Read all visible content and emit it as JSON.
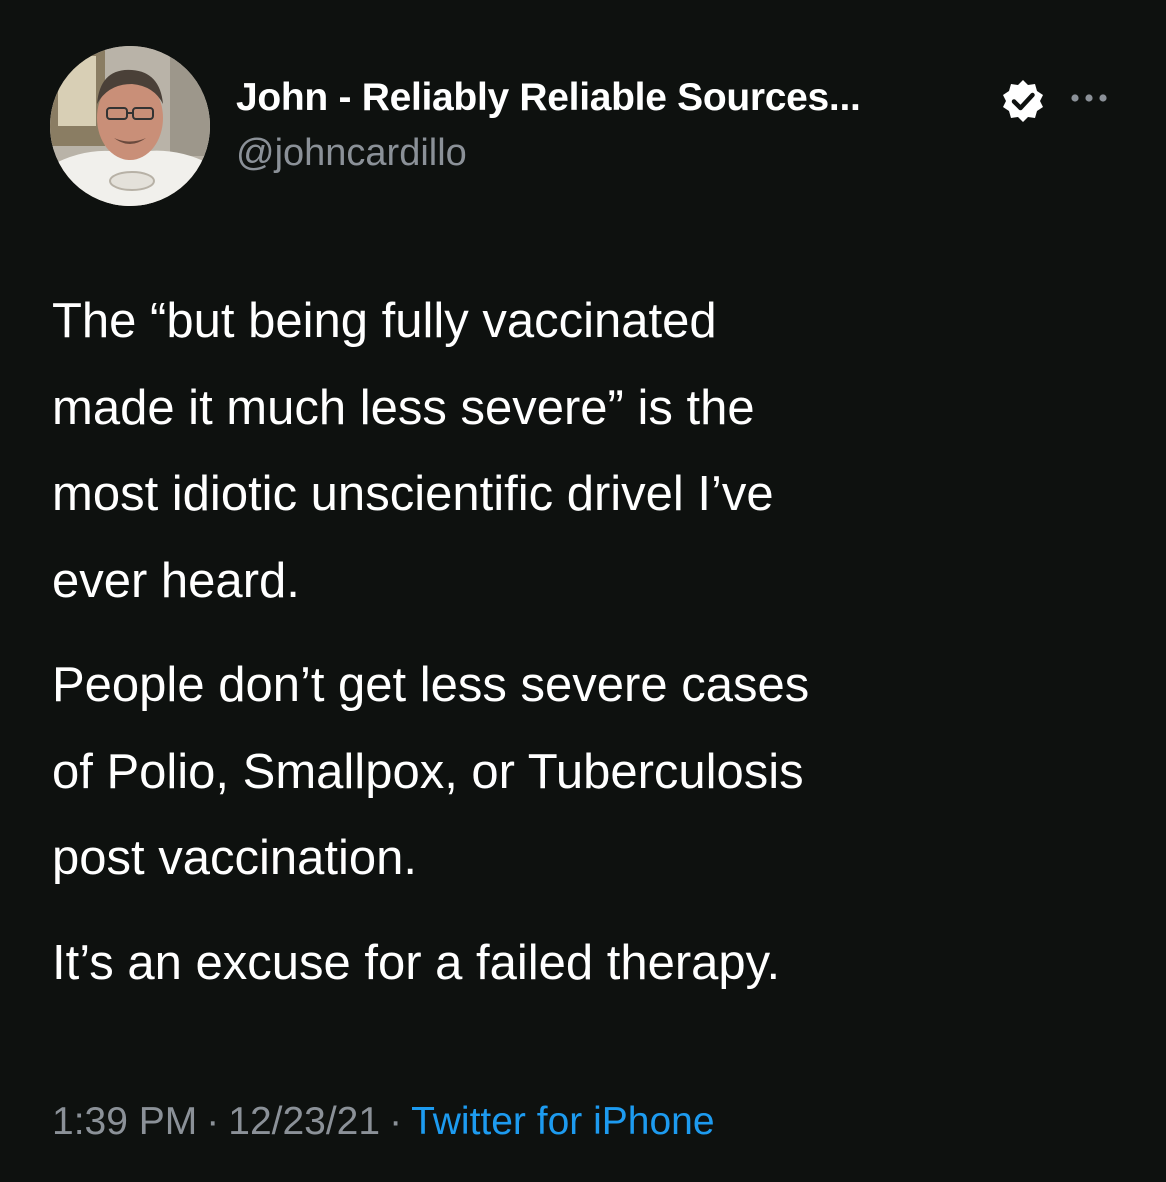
{
  "author": {
    "display_name": "John - Reliably Reliable Sources...",
    "handle": "@johncardillo",
    "verified_icon": "verified-badge-icon",
    "more_icon": "more-options-icon"
  },
  "tweet": {
    "paragraphs": [
      {
        "lines": [
          "The “but being fully vaccinated",
          "made it much less severe” is the",
          "most idiotic unscientific drivel I’ve",
          "ever heard."
        ]
      },
      {
        "lines": [
          "People don’t get less severe cases",
          "of Polio, Smallpox, or Tuberculosis",
          "post vaccination."
        ]
      },
      {
        "lines": [
          "It’s an excuse for a failed therapy."
        ]
      }
    ]
  },
  "meta": {
    "time": "1:39 PM",
    "separator": "·",
    "date": "12/23/21",
    "source": "Twitter for iPhone"
  },
  "colors": {
    "background": "#0e110f",
    "text": "#ffffff",
    "secondary_text": "#8b9198",
    "link": "#1d9bf0"
  }
}
